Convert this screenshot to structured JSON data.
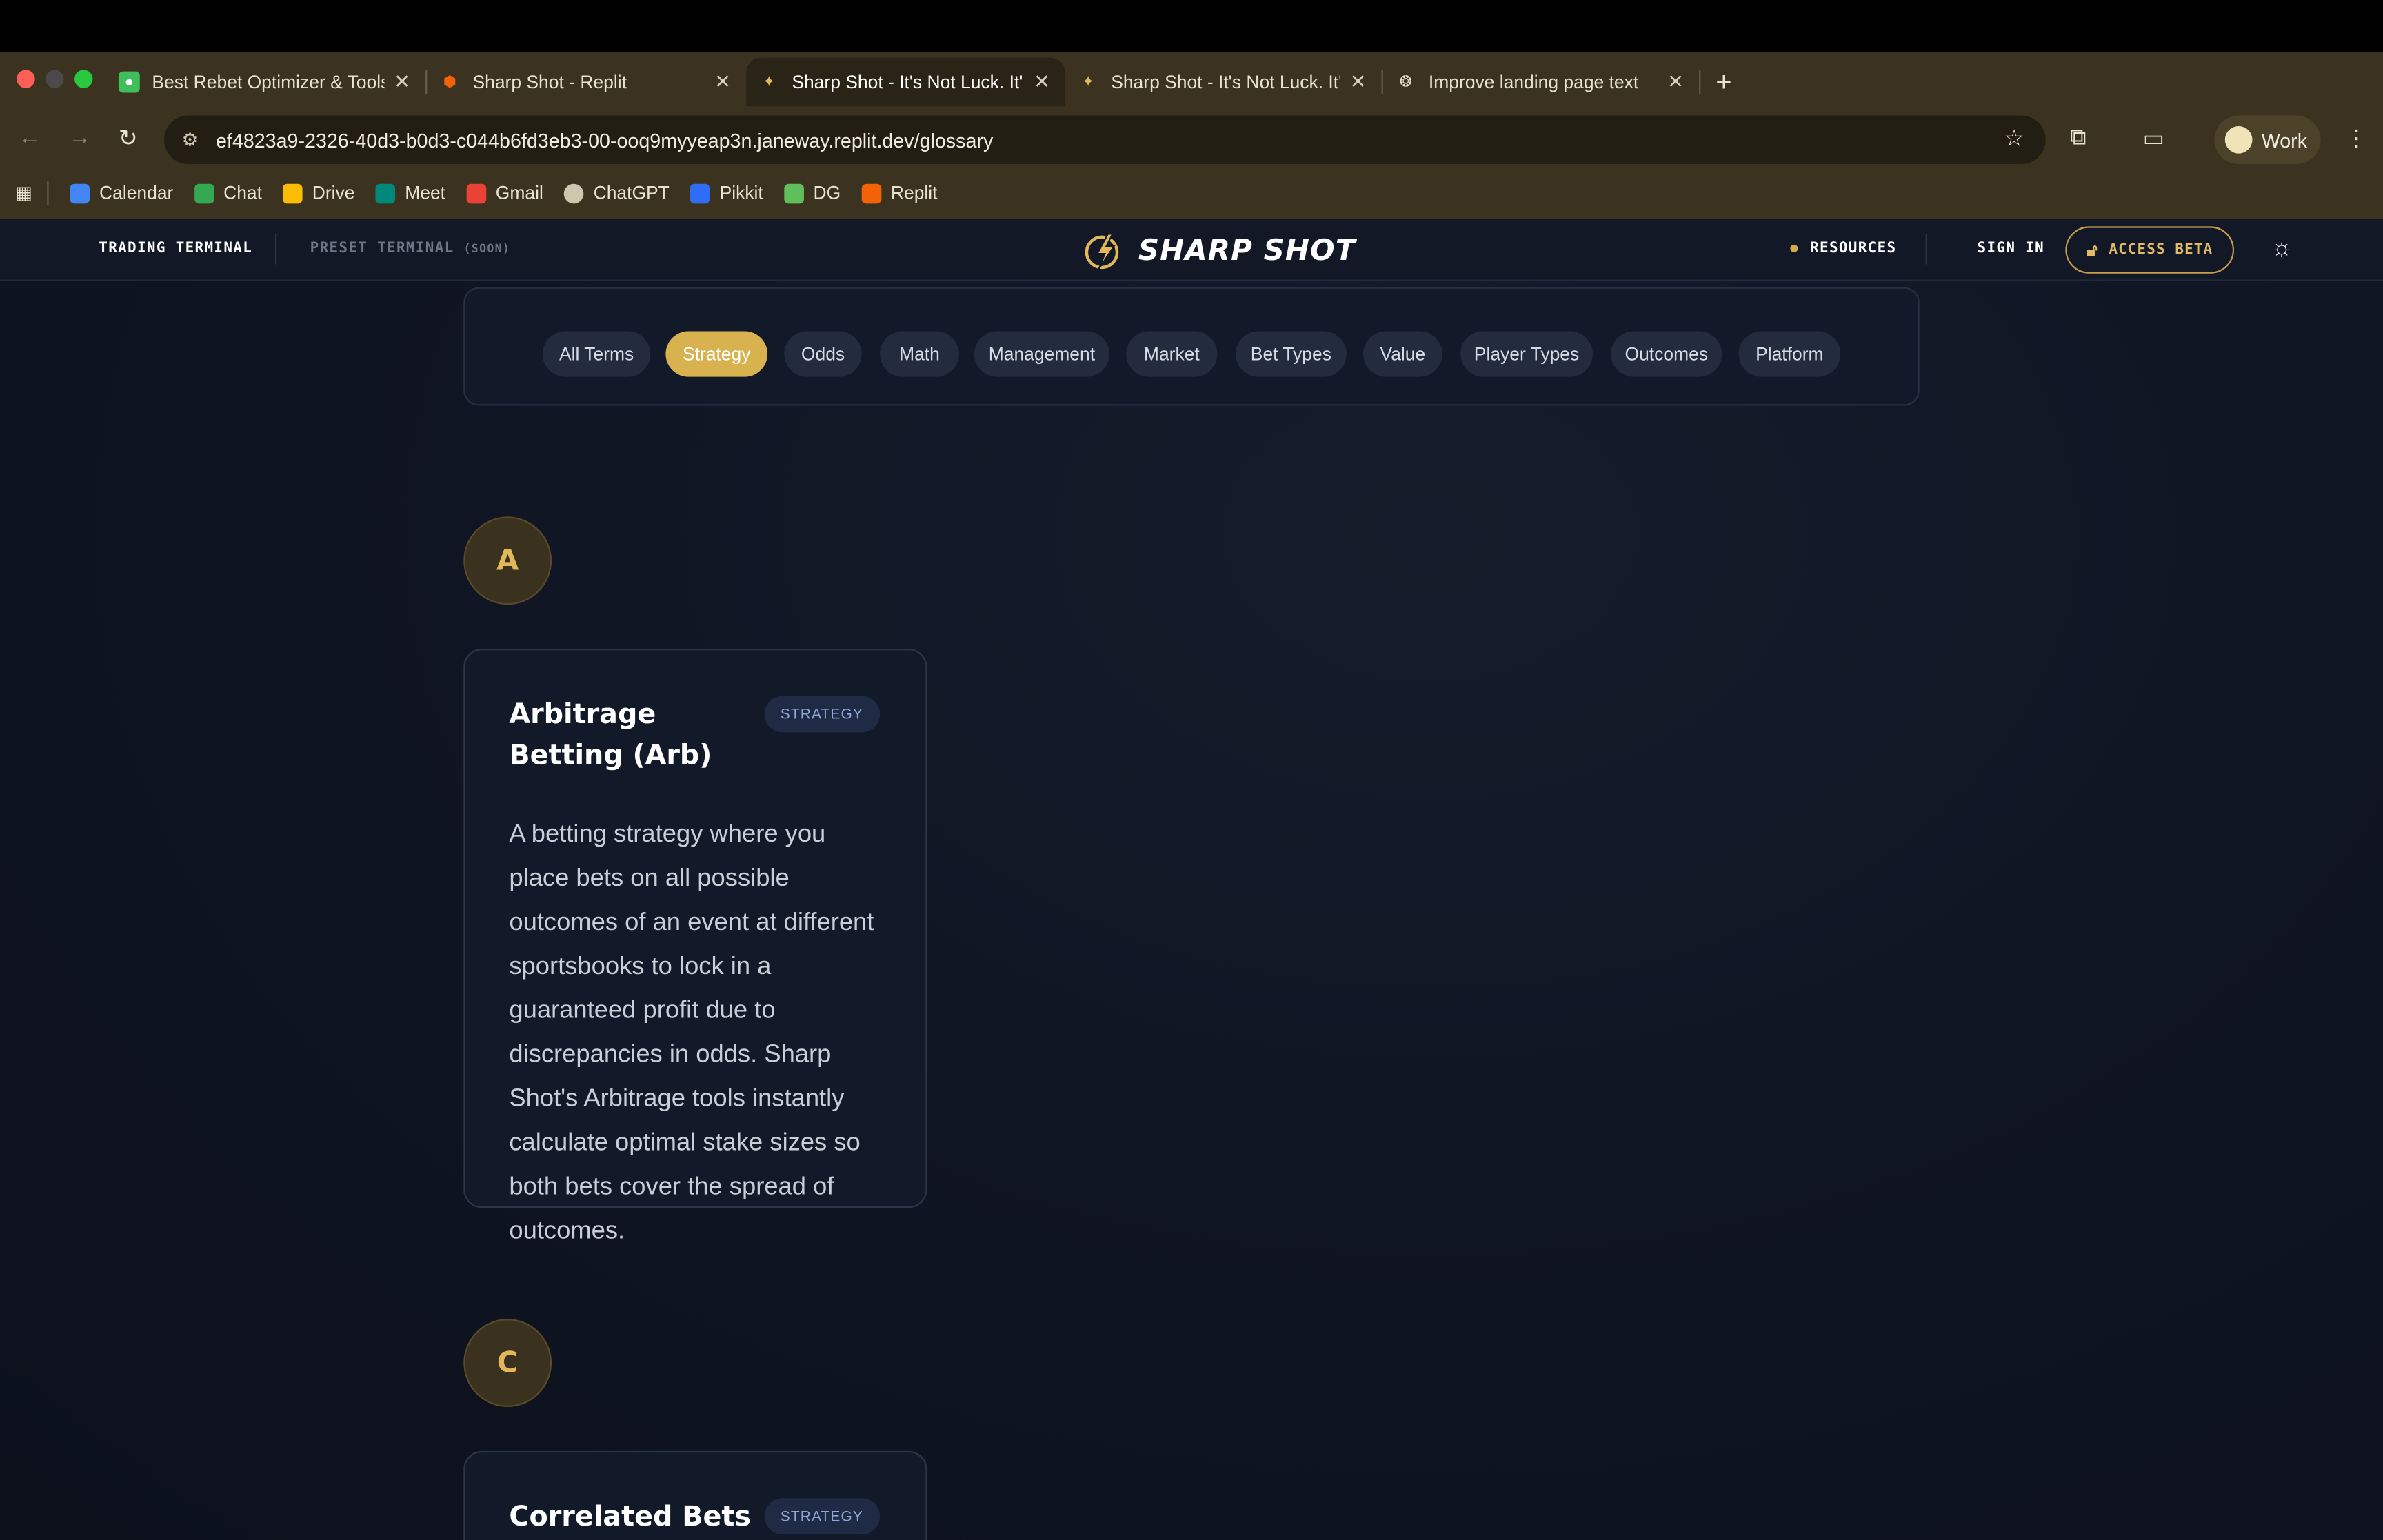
{
  "browser": {
    "tabs": [
      {
        "title": "Best Rebet Optimizer & Tools",
        "active": false
      },
      {
        "title": "Sharp Shot - Replit",
        "active": false
      },
      {
        "title": "Sharp Shot - It's Not Luck. It'",
        "active": true
      },
      {
        "title": "Sharp Shot - It's Not Luck. It'",
        "active": false
      },
      {
        "title": "Improve landing page text",
        "active": false
      }
    ],
    "url": "ef4823a9-2326-40d3-b0d3-c044b6fd3eb3-00-ooq9myyeap3n.janeway.replit.dev/glossary",
    "profile_label": "Work",
    "bookmarks": [
      {
        "label": "Calendar",
        "color": "#4285f4"
      },
      {
        "label": "Chat",
        "color": "#34a853"
      },
      {
        "label": "Drive",
        "color": "#fbbc04"
      },
      {
        "label": "Meet",
        "color": "#00897b"
      },
      {
        "label": "Gmail",
        "color": "#ea4335"
      },
      {
        "label": "ChatGPT",
        "color": "#cfc6b0"
      },
      {
        "label": "Pikkit",
        "color": "#2f6df6"
      },
      {
        "label": "DG",
        "color": "#5fbf5a"
      },
      {
        "label": "Replit",
        "color": "#f26207"
      }
    ]
  },
  "header": {
    "trading_terminal": "TRADING TERMINAL",
    "preset_terminal": "PRESET TERMINAL",
    "preset_soon": "(SOON)",
    "brand": "SHARP SHOT",
    "resources": "RESOURCES",
    "sign_in": "SIGN IN",
    "access_beta": "ACCESS BETA"
  },
  "filters": [
    {
      "label": "All Terms",
      "active": false
    },
    {
      "label": "Strategy",
      "active": true
    },
    {
      "label": "Odds",
      "active": false
    },
    {
      "label": "Math",
      "active": false
    },
    {
      "label": "Management",
      "active": false
    },
    {
      "label": "Market",
      "active": false
    },
    {
      "label": "Bet Types",
      "active": false
    },
    {
      "label": "Value",
      "active": false
    },
    {
      "label": "Player Types",
      "active": false
    },
    {
      "label": "Outcomes",
      "active": false
    },
    {
      "label": "Platform",
      "active": false
    }
  ],
  "sections": [
    {
      "letter": "A",
      "terms": [
        {
          "title": "Arbitrage Betting (Arb)",
          "category": "STRATEGY",
          "description": "A betting strategy where you place bets on all possible outcomes of an event at different sportsbooks to lock in a guaranteed profit due to discrepancies in odds. Sharp Shot's Arbitrage tools instantly calculate optimal stake sizes so both bets cover the spread of outcomes."
        }
      ]
    },
    {
      "letter": "C",
      "terms": [
        {
          "title": "Correlated Bets",
          "category": "STRATEGY"
        }
      ]
    }
  ],
  "colors": {
    "accent_gold": "#d8b24f",
    "page_bg": "#0f1522",
    "card_bg": "#121a29"
  }
}
